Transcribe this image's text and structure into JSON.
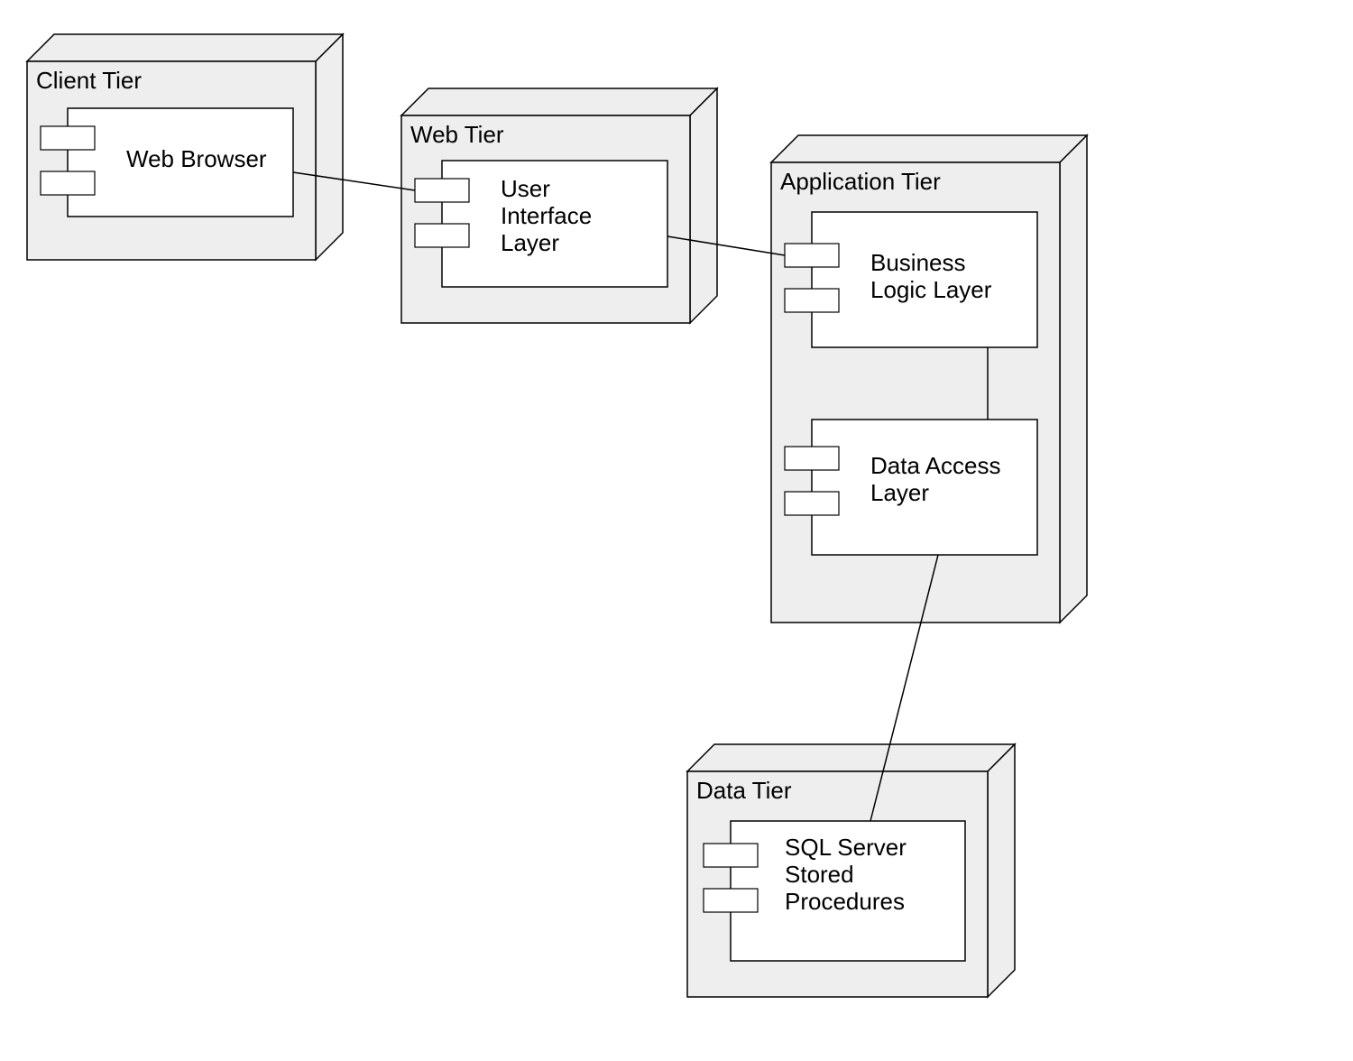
{
  "nodes": {
    "client": {
      "title": "Client Tier",
      "components": [
        {
          "label": "Web Browser"
        }
      ]
    },
    "web": {
      "title": "Web Tier",
      "components": [
        {
          "label": "User\nInterface\nLayer"
        }
      ]
    },
    "app": {
      "title": "Application Tier",
      "components": [
        {
          "label": "Business\nLogic Layer"
        },
        {
          "label": "Data Access\nLayer"
        }
      ]
    },
    "data": {
      "title": "Data Tier",
      "components": [
        {
          "label": "SQL Server\nStored\nProcedures"
        }
      ]
    }
  }
}
